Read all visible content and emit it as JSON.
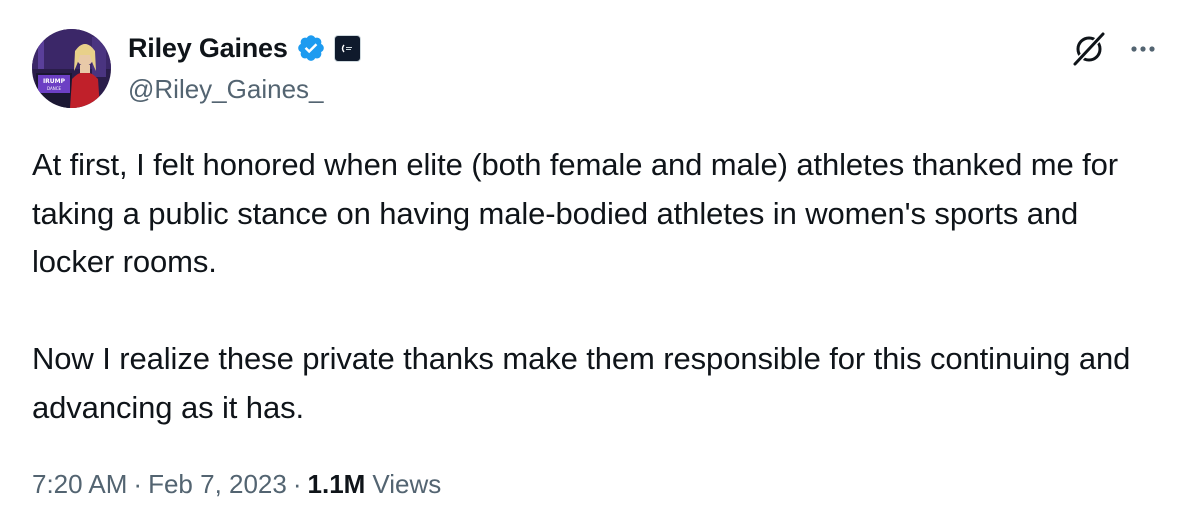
{
  "author": {
    "display_name": "Riley Gaines",
    "handle": "@Riley_Gaines_",
    "verified": true,
    "verified_color": "#1d9bf0",
    "avatar_icon": "profile-photo",
    "affiliate_badge_icon": "organization-affiliate-badge"
  },
  "actions": {
    "grok_icon": "grok-icon",
    "more_icon": "more-options-icon"
  },
  "tweet": {
    "paragraphs": [
      "At first, I felt honored when elite (both female and male) athletes thanked me for taking a public stance on having male-bodied athletes in women's sports and locker rooms.",
      "Now I realize these private thanks make them responsible for this continuing and advancing as it has."
    ]
  },
  "meta": {
    "time": "7:20 AM",
    "separator": "·",
    "date": "Feb 7, 2023",
    "views_count": "1.1M",
    "views_label": "Views"
  },
  "colors": {
    "text_primary": "#0f1419",
    "text_secondary": "#536471",
    "verified_blue": "#1d9bf0"
  }
}
